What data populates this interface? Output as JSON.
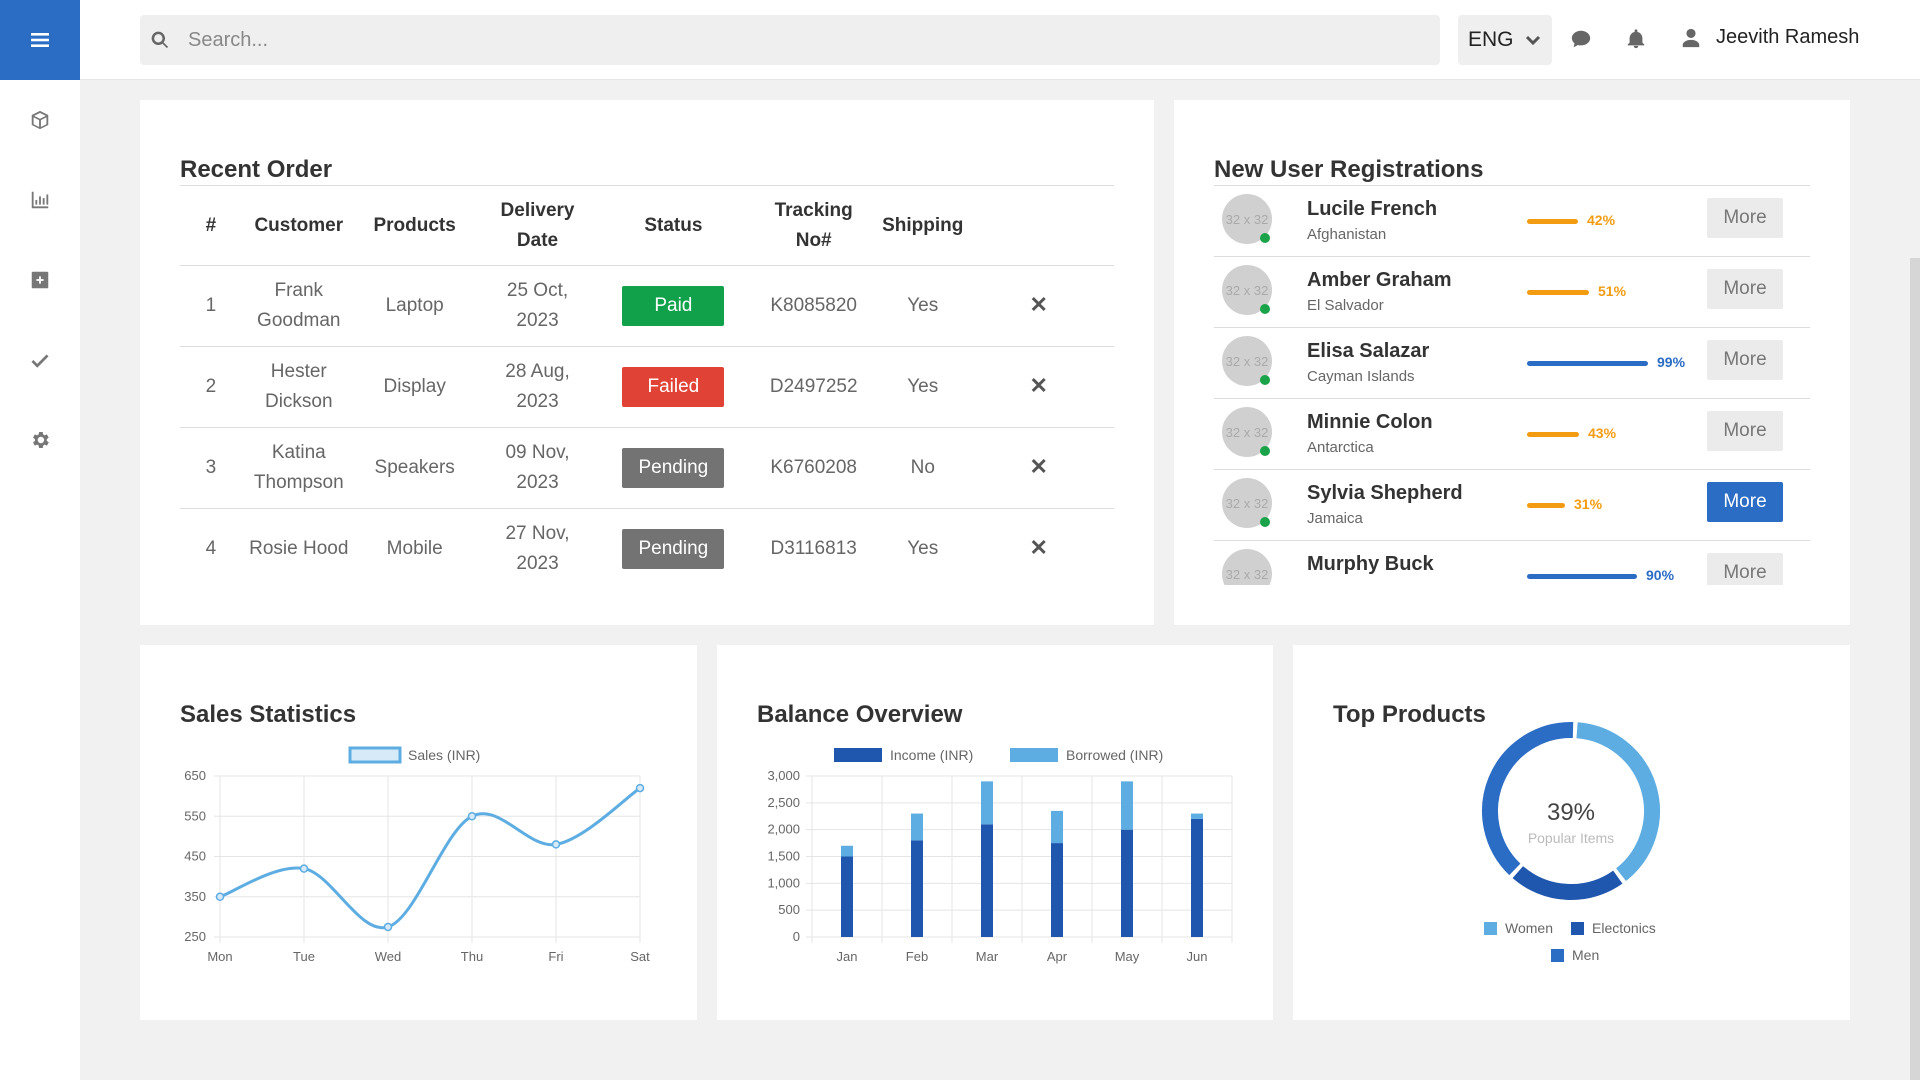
{
  "search": {
    "placeholder": "Search..."
  },
  "header": {
    "language": "ENG",
    "user_name": "Jeevith Ramesh"
  },
  "orders": {
    "title": "Recent Order",
    "columns": [
      "#",
      "Customer",
      "Products",
      "Delivery Date",
      "Status",
      "Tracking No#",
      "Shipping"
    ],
    "columns_display": [
      [
        "#"
      ],
      [
        "Customer"
      ],
      [
        "Products"
      ],
      [
        "Delivery",
        "Date"
      ],
      [
        "Status"
      ],
      [
        "Tracking",
        "No#"
      ],
      [
        "Shipping"
      ]
    ],
    "rows": [
      {
        "num": "1",
        "customer": [
          "Frank",
          "Goodman"
        ],
        "product": "Laptop",
        "date": [
          "25 Oct,",
          "2023"
        ],
        "status": "Paid",
        "status_color": "#12a14b",
        "tracking": "K8085820",
        "shipping": "Yes"
      },
      {
        "num": "2",
        "customer": [
          "Hester",
          "Dickson"
        ],
        "product": "Display",
        "date": [
          "28 Aug,",
          "2023"
        ],
        "status": "Failed",
        "status_color": "#e04335",
        "tracking": "D2497252",
        "shipping": "Yes"
      },
      {
        "num": "3",
        "customer": [
          "Katina",
          "Thompson"
        ],
        "product": "Speakers",
        "date": [
          "09 Nov,",
          "2023"
        ],
        "status": "Pending",
        "status_color": "#737373",
        "tracking": "K6760208",
        "shipping": "No"
      },
      {
        "num": "4",
        "customer": [
          "Rosie Hood"
        ],
        "product": "Mobile",
        "date": [
          "27 Nov,",
          "2023"
        ],
        "status": "Pending",
        "status_color": "#737373",
        "tracking": "D3116813",
        "shipping": "Yes"
      }
    ],
    "delete_icon": "close-icon"
  },
  "users": {
    "title": "New User Registrations",
    "avatar_placeholder": "32 x 32",
    "items": [
      {
        "name": "Lucile French",
        "country": "Afghanistan",
        "percent": 42,
        "percent_label": "42%",
        "color": "#f39c12",
        "more": "More",
        "active": false,
        "online": true
      },
      {
        "name": "Amber Graham",
        "country": "El Salvador",
        "percent": 51,
        "percent_label": "51%",
        "color": "#f39c12",
        "more": "More",
        "active": false,
        "online": true
      },
      {
        "name": "Elisa Salazar",
        "country": "Cayman Islands",
        "percent": 99,
        "percent_label": "99%",
        "color": "#2b6cc4",
        "more": "More",
        "active": false,
        "online": true
      },
      {
        "name": "Minnie Colon",
        "country": "Antarctica",
        "percent": 43,
        "percent_label": "43%",
        "color": "#f39c12",
        "more": "More",
        "active": false,
        "online": true
      },
      {
        "name": "Sylvia Shepherd",
        "country": "Jamaica",
        "percent": 31,
        "percent_label": "31%",
        "color": "#f39c12",
        "more": "More",
        "active": true,
        "online": true
      },
      {
        "name": "Murphy Buck",
        "country": "",
        "percent": 90,
        "percent_label": "90%",
        "color": "#2b6cc4",
        "more": "More",
        "active": false,
        "online": false
      }
    ]
  },
  "sales": {
    "title": "Sales Statistics"
  },
  "balance": {
    "title": "Balance Overview"
  },
  "top_products": {
    "title": "Top Products"
  },
  "chart_data": [
    {
      "type": "line",
      "title": "Sales Statistics",
      "categories": [
        "Mon",
        "Tue",
        "Wed",
        "Thu",
        "Fri",
        "Sat"
      ],
      "series": [
        {
          "name": "Sales (INR)",
          "values": [
            350,
            420,
            275,
            550,
            480,
            620
          ],
          "color": "#5dade2"
        }
      ],
      "ylim": [
        250,
        650
      ],
      "yticks": [
        250,
        350,
        450,
        550,
        650
      ],
      "legend": "top"
    },
    {
      "type": "bar",
      "stacked": true,
      "title": "Balance Overview",
      "categories": [
        "Jan",
        "Feb",
        "Mar",
        "Apr",
        "May",
        "Jun"
      ],
      "series": [
        {
          "name": "Income (INR)",
          "values": [
            1500,
            1800,
            2100,
            1750,
            2000,
            2200
          ],
          "color": "#1f56ae"
        },
        {
          "name": "Borrowed (INR)",
          "values": [
            200,
            500,
            800,
            600,
            900,
            100
          ],
          "color": "#5dade2"
        }
      ],
      "ylim": [
        0,
        3000
      ],
      "yticks": [
        "0",
        "500",
        "1,000",
        "1,500",
        "2,000",
        "2,500",
        "3,000"
      ],
      "legend": "top"
    },
    {
      "type": "pie",
      "title": "Top Products",
      "center_value": "39%",
      "center_label": "Popular Items",
      "categories": [
        "Women",
        "Electonics",
        "Men"
      ],
      "values": [
        39,
        22,
        39
      ],
      "colors": [
        "#5dade2",
        "#1f56ae",
        "#2b6cc4"
      ],
      "legend": "bottom"
    }
  ]
}
